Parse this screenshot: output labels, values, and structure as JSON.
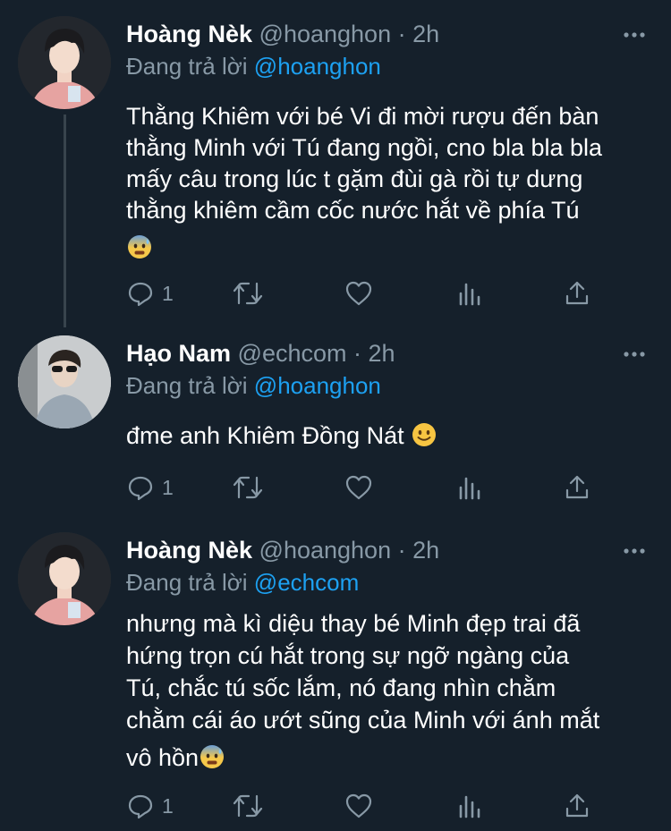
{
  "tweets": [
    {
      "name": "Hoàng Nèk",
      "handle": "@hoanghon",
      "dot": "·",
      "time": "2h",
      "reply_prefix": "Đang trả lời",
      "reply_to": "@hoanghon",
      "lines": [
        "Thằng Khiêm với bé Vi đi mời rượu đến bàn",
        "thằng Minh với Tú đang ngồi, cno bla bla bla",
        "mấy câu trong lúc t gặm đùi gà rồi tự dưng",
        "thằng khiêm cầm cốc nước hắt về phía Tú"
      ],
      "emoji": "anxious-face-with-sweat",
      "reply_count": "1"
    },
    {
      "name": "Hạo Nam",
      "handle": "@echcom",
      "dot": "·",
      "time": "2h",
      "reply_prefix": "Đang trả lời",
      "reply_to": "@hoanghon",
      "lines": [
        "đme anh Khiêm Đồng Nát"
      ],
      "emoji": "slightly-smiling-face",
      "reply_count": "1"
    },
    {
      "name": "Hoàng Nèk",
      "handle": "@hoanghon",
      "dot": "·",
      "time": "2h",
      "reply_prefix": "Đang trả lời",
      "reply_to": "@echcom",
      "lines": [
        "nhưng mà kì diệu thay bé Minh đẹp trai đã",
        "hứng trọn cú hắt trong sự ngỡ ngàng của",
        "Tú, chắc tú sốc lắm, nó đang nhìn chằm",
        "chằm cái áo ướt sũng của Minh với ánh mắt",
        "vô hồn"
      ],
      "emoji": "anxious-face-with-sweat",
      "reply_count": "1"
    }
  ],
  "colors": {
    "background": "#15202b",
    "text": "#ffffff",
    "muted": "#8899a6",
    "link": "#1da1f2",
    "thread_line": "#38444d"
  },
  "icons": [
    "reply-icon",
    "retweet-icon",
    "like-icon",
    "analytics-icon",
    "share-icon",
    "more-icon"
  ]
}
